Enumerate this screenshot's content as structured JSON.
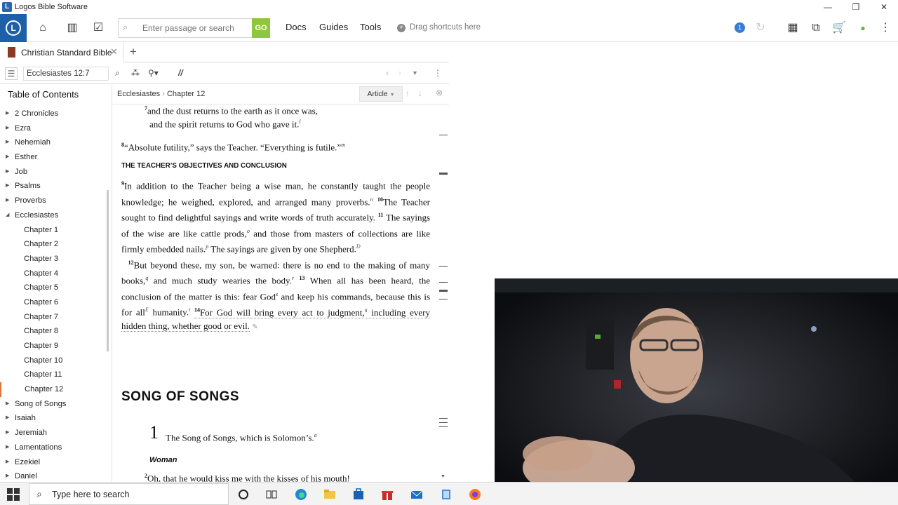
{
  "window": {
    "title": "Logos Bible Software",
    "controls": [
      "—",
      "❐",
      "✕"
    ]
  },
  "toolbar": {
    "search_placeholder": "Enter passage or search",
    "go_label": "GO",
    "menus": [
      "Docs",
      "Guides",
      "Tools"
    ],
    "drag_shortcuts": "Drag shortcuts here",
    "notification_count": "1"
  },
  "tab": {
    "title": "Christian Standard Bible",
    "close": "✕",
    "new": "+"
  },
  "panel": {
    "reference": "Ecclesiastes 12:7",
    "parallel_label": "//"
  },
  "toc": {
    "title": "Table of Contents",
    "items": [
      {
        "label": "2 Chronicles",
        "type": "book"
      },
      {
        "label": "Ezra",
        "type": "book"
      },
      {
        "label": "Nehemiah",
        "type": "book"
      },
      {
        "label": "Esther",
        "type": "book"
      },
      {
        "label": "Job",
        "type": "book"
      },
      {
        "label": "Psalms",
        "type": "book"
      },
      {
        "label": "Proverbs",
        "type": "book"
      },
      {
        "label": "Ecclesiastes",
        "type": "book",
        "expanded": true
      },
      {
        "label": "Chapter 1",
        "type": "chapter"
      },
      {
        "label": "Chapter 2",
        "type": "chapter"
      },
      {
        "label": "Chapter 3",
        "type": "chapter"
      },
      {
        "label": "Chapter 4",
        "type": "chapter"
      },
      {
        "label": "Chapter 5",
        "type": "chapter"
      },
      {
        "label": "Chapter 6",
        "type": "chapter"
      },
      {
        "label": "Chapter 7",
        "type": "chapter"
      },
      {
        "label": "Chapter 8",
        "type": "chapter"
      },
      {
        "label": "Chapter 9",
        "type": "chapter"
      },
      {
        "label": "Chapter 10",
        "type": "chapter"
      },
      {
        "label": "Chapter 11",
        "type": "chapter"
      },
      {
        "label": "Chapter 12",
        "type": "chapter",
        "active": true
      },
      {
        "label": "Song of Songs",
        "type": "book"
      },
      {
        "label": "Isaiah",
        "type": "book"
      },
      {
        "label": "Jeremiah",
        "type": "book"
      },
      {
        "label": "Lamentations",
        "type": "book"
      },
      {
        "label": "Ezekiel",
        "type": "book"
      },
      {
        "label": "Daniel",
        "type": "book"
      }
    ]
  },
  "reader": {
    "breadcrumb_book": "Ecclesiastes",
    "breadcrumb_chapter": "Chapter 12",
    "article_label": "Article",
    "v7_num": "7",
    "v7_line1": "and the dust returns to the earth as it once was,",
    "v7_line2": "and the spirit returns to God who gave it.",
    "v7_fn": "l",
    "v8_num": "8",
    "v8_text": "“Absolute futility,” says the Teacher. “Everything is futile.”",
    "v8_fn": "m",
    "section_heading": "THE TEACHER’S OBJECTIVES AND CONCLUSION",
    "v9_num": "9",
    "v9_text": "In addition to the Teacher being a wise man, he constantly taught the people knowledge; he weighed, explored, and arranged many proverbs.",
    "v9_fn": "n",
    "v10_num": "10",
    "v10_text": "The Teacher sought to find delightful sayings and write words of truth accurately.",
    "v11_num": "11",
    "v11_text_a": "The sayings of the wise are like cattle prods,",
    "v11_fn_a": "o",
    "v11_text_b": "and those from masters of collections are like firmly embedded nails.",
    "v11_fn_b": "p",
    "v11_text_c": "The sayings are given by one Shepherd.",
    "v11_fn_c": "D",
    "v12_num": "12",
    "v12_text": "But beyond these, my son, be warned: there is no end to the making of many books,",
    "v12_fn": "q",
    "v12_text_b": "and much study wearies the body.",
    "v12_fn_b": "r",
    "v13_num": "13",
    "v13_text_a": "When all has been heard, the conclusion of the matter is this: fear God",
    "v13_fn_a": "s",
    "v13_text_b": "and keep his commands, because this is for all",
    "v13_fn_b": "E",
    "v13_text_c": "humanity.",
    "v13_fn_c": "t",
    "v14_num": "14",
    "v14_text_a": "For God will bring every act to judgment,",
    "v14_fn": "u",
    "v14_text_b": "including every hidden thing, whether good or evil.",
    "book_heading": "SONG OF SONGS",
    "chapter_number": "1",
    "song_v1": "The Song of Songs, which is Solomon’s.",
    "song_v1_fn": "a",
    "speaker": "Woman",
    "song_v2_num": "2",
    "song_v2": "Oh, that he would kiss me with the kisses of his mouth!"
  },
  "taskbar": {
    "search_text": "Type here to search"
  },
  "colors": {
    "accent_blue": "#1d5fa8",
    "go_green": "#8dc63f",
    "active_orange": "#d9743a"
  }
}
